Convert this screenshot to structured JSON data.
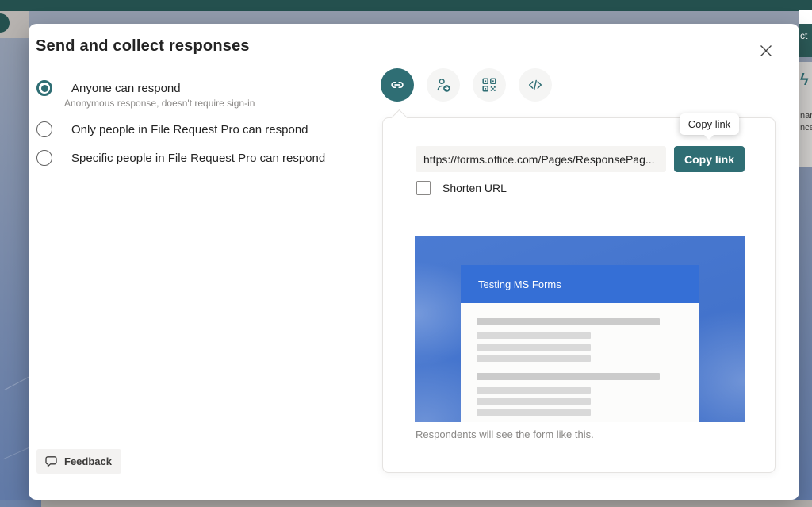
{
  "colors": {
    "accent_teal": "#2f6e74",
    "topbar_teal": "#24504e",
    "preview_blue": "#4577cd",
    "preview_header_blue": "#356fd6"
  },
  "background": {
    "collect_button_fragment": "ct",
    "illustration_glyph": "ϟ",
    "text_fragment_1": "nar",
    "text_fragment_2": "nce"
  },
  "dialog": {
    "title": "Send and collect responses",
    "options": [
      {
        "label": "Anyone can respond",
        "sublabel": "Anonymous response, doesn't require sign-in",
        "selected": true
      },
      {
        "label": "Only people in File Request Pro can respond",
        "selected": false
      },
      {
        "label": "Specific people in File Request Pro can respond",
        "selected": false
      }
    ],
    "share_tabs": [
      {
        "icon": "link-icon",
        "selected": true
      },
      {
        "icon": "share-to-people-icon",
        "selected": false
      },
      {
        "icon": "qr-code-icon",
        "selected": false
      },
      {
        "icon": "embed-code-icon",
        "selected": false
      }
    ],
    "link_panel": {
      "url_value": "https://forms.office.com/Pages/ResponsePag...",
      "copy_button_label": "Copy link",
      "tooltip_label": "Copy link",
      "shorten_url_label": "Shorten URL",
      "preview": {
        "form_title": "Testing MS Forms",
        "caption": "Respondents will see the form like this."
      }
    },
    "feedback_label": "Feedback"
  }
}
